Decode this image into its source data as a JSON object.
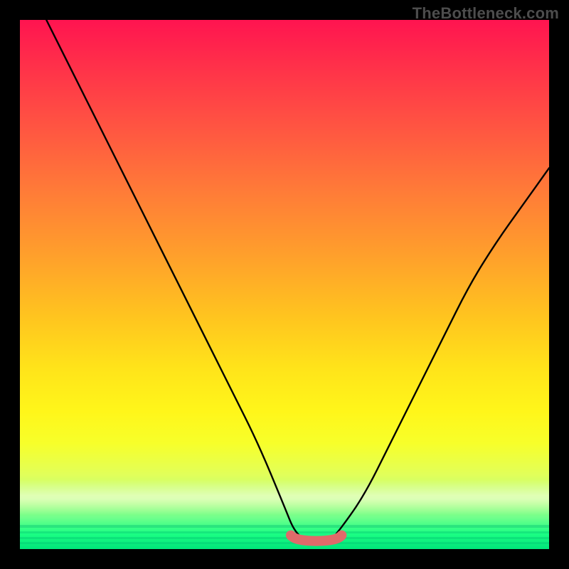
{
  "watermark": "TheBottleneck.com",
  "colors": {
    "background": "#000000",
    "curve": "#000000",
    "valley_highlight": "#e06a6a",
    "gradient_top": "#ff1450",
    "gradient_bottom": "#00e67a"
  },
  "chart_data": {
    "type": "line",
    "title": "",
    "xlabel": "",
    "ylabel": "",
    "xlim": [
      0,
      100
    ],
    "ylim": [
      0,
      100
    ],
    "series": [
      {
        "name": "bottleneck-curve",
        "x": [
          5,
          10,
          15,
          20,
          25,
          30,
          35,
          40,
          45,
          50,
          52,
          55,
          58,
          60,
          65,
          70,
          75,
          80,
          85,
          90,
          95,
          100
        ],
        "y": [
          100,
          90,
          80,
          70,
          60,
          50,
          40,
          30,
          20,
          8,
          3,
          1,
          1,
          3,
          10,
          20,
          30,
          40,
          50,
          58,
          65,
          72
        ]
      }
    ],
    "annotations": [
      {
        "name": "valley-flat-highlight",
        "x_range": [
          52,
          60
        ],
        "y": 1,
        "color": "#e06a6a"
      }
    ],
    "grid": false,
    "legend": false
  }
}
